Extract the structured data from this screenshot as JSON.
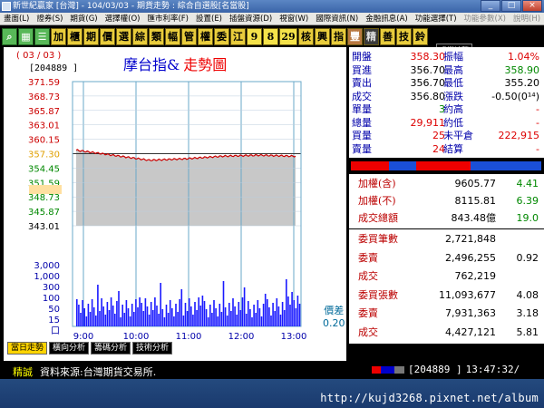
{
  "window": {
    "title": "新世紀贏家 [台灣] - 104/03/03 - 期貨走勢 : 綜合自選股[名當股]"
  },
  "menu": [
    "畫面(L)",
    "證券(S)",
    "期貨(G)",
    "選擇權(O)",
    "匯市利率(F)",
    "設置(E)",
    "插盤資源(D)",
    "視窗(W)",
    "國際資訊(N)",
    "金融訊息(A)",
    "功能選擇(T)",
    "功能參數(X)",
    "說明(H)"
  ],
  "toolbar": {
    "icons": [
      "search-icon",
      "chart-icon",
      "list-icon"
    ],
    "buttons": [
      "加",
      "櫃",
      "期",
      "價",
      "選",
      "綜",
      "類",
      "幅",
      "管",
      "權",
      "委",
      "江"
    ],
    "numbers": [
      "9",
      "8",
      "29"
    ],
    "buttons2": [
      "核",
      "興",
      "指",
      "豐",
      "精",
      "善",
      "技",
      "鈴"
    ],
    "tooltip": "盧業綜覽"
  },
  "chart": {
    "date": "( 03 / 03 )",
    "code": "[204889 ]",
    "title_main": "摩台指&",
    "title_sub": "走勢圖",
    "price_labels": [
      "371.59",
      "368.73",
      "365.87",
      "363.01",
      "360.15",
      "357.30",
      "354.45",
      "351.59",
      "348.73",
      "345.87",
      "343.01"
    ],
    "volume_labels": [
      "3,000",
      "1,000",
      "300",
      "100",
      "50",
      "15",
      "口"
    ],
    "time_labels": [
      "9:00",
      "10:00",
      "11:00",
      "12:00",
      "13:00"
    ],
    "spread_label": "價差",
    "spread_value": "0.20"
  },
  "chart_data": {
    "type": "line",
    "title": "摩台指& 走勢圖",
    "ylim": [
      343.01,
      371.59
    ],
    "reference": 357.3,
    "x": [
      "9:00",
      "10:00",
      "11:00",
      "12:00",
      "13:00"
    ],
    "series": [
      {
        "values": [
          358.0,
          357.0,
          356.0,
          356.3,
          356.8,
          357.0,
          356.8
        ]
      }
    ]
  },
  "quote": {
    "rows": [
      {
        "l1": "開盤",
        "v1": "358.30",
        "c1": "red",
        "l2": "振幅",
        "v2": "1.04%",
        "c2": "red"
      },
      {
        "l1": "買進",
        "v1": "356.70",
        "c1": "",
        "l2": "最高",
        "v2": "358.90",
        "c2": "green"
      },
      {
        "l1": "賣出",
        "v1": "356.70",
        "c1": "",
        "l2": "最低",
        "v2": "355.20",
        "c2": ""
      },
      {
        "l1": "成交",
        "v1": "356.80",
        "c1": "",
        "l2": "漲跌",
        "v2": "-0.50(0¹⁴)",
        "c2": ""
      },
      {
        "l1": "單量",
        "v1": "3",
        "c1": "green",
        "l2": "約高",
        "v2": "-",
        "c2": "red"
      },
      {
        "l1": "總量",
        "v1": "29,911",
        "c1": "red",
        "l2": "約低",
        "v2": "-",
        "c2": "red"
      },
      {
        "l1": "買量",
        "v1": "25",
        "c1": "red",
        "l2": "未平倉",
        "v2": "222,915",
        "c2": "red"
      },
      {
        "l1": "賣量",
        "v1": "24",
        "c1": "red",
        "l2": "結算",
        "v2": "-",
        "c2": "red"
      }
    ]
  },
  "index_panel": [
    {
      "label": "加權(含)",
      "value": "9605.77",
      "change": "4.41"
    },
    {
      "label": "加權(不)",
      "value": "8115.81",
      "change": "6.39"
    },
    {
      "label": "成交總額",
      "value": "843.48億",
      "change": "19.0"
    }
  ],
  "order_panel": [
    {
      "label": "委買筆數",
      "value": "2,721,848",
      "extra": ""
    },
    {
      "label": "委賣",
      "value": "2,496,255",
      "extra": "0.92"
    },
    {
      "label": "成交",
      "value": "762,219",
      "extra": ""
    },
    {
      "label": "委買張數",
      "value": "11,093,677",
      "extra": "4.08"
    },
    {
      "label": "委賣",
      "value": "7,931,363",
      "extra": "3.18"
    },
    {
      "label": "成交",
      "value": "4,427,121",
      "extra": "5.81"
    }
  ],
  "tabs": [
    "當日走勢",
    "橫向分析",
    "籌碼分析",
    "技術分析"
  ],
  "status": {
    "left_key": "精誠",
    "left_text": "資料來源:台灣期貨交易所.",
    "code": "[204889 ]",
    "time": "13:47:32/"
  },
  "watermark": "http://kujd3268.pixnet.net/album",
  "colors": {
    "toolbar_yellow": "#e8cc3c",
    "price_line": "#cc0000",
    "volume_bar": "#1a1aff"
  }
}
